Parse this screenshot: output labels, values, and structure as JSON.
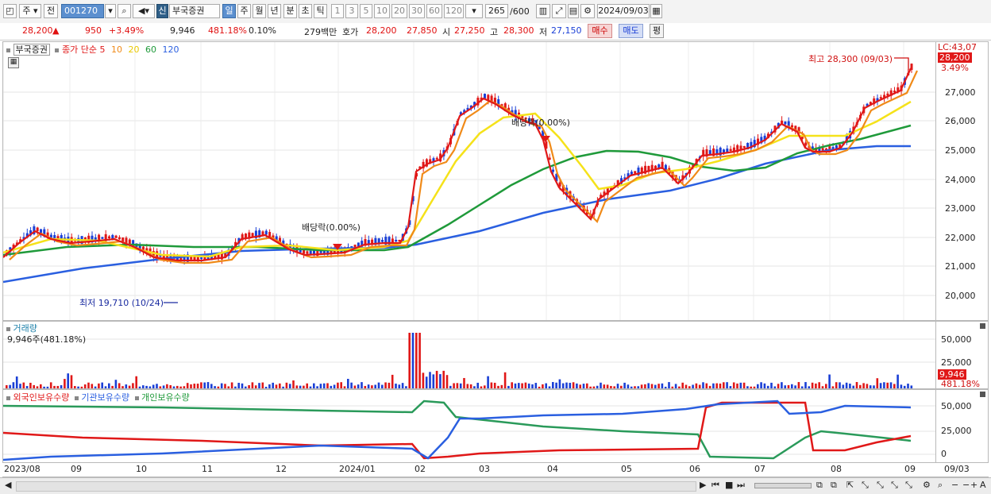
{
  "toolbar": {
    "market": "주",
    "prev": "전",
    "code": "001270",
    "new_badge": "신",
    "stock_name": "부국증권",
    "periods": [
      "일",
      "주",
      "월",
      "년",
      "분",
      "초",
      "틱"
    ],
    "active_period": "일",
    "intervals": [
      "1",
      "3",
      "5",
      "10",
      "20",
      "30",
      "60",
      "120"
    ],
    "count": "265",
    "count_total": "/600",
    "date": "2024/09/03"
  },
  "info": {
    "price": "28,200",
    "up_arrow": "▲",
    "change": "950",
    "change_pct": "+3.49%",
    "volume": "9,946",
    "volume_pct": "481.18%",
    "turnover_pct": "0.10%",
    "amount": "279백만",
    "bid_label": "호가",
    "bid1": "28,200",
    "bid2": "27,850",
    "open_label": "시",
    "open": "27,250",
    "high_label": "고",
    "high": "28,300",
    "low_label": "저",
    "low": "27,150",
    "buy": "매수",
    "sell": "매도",
    "eval": "평"
  },
  "price_panel": {
    "name": "부국증권",
    "legend_label": "종가 단순",
    "ma_periods": [
      "5",
      "10",
      "20",
      "60",
      "120"
    ],
    "ma_colors": [
      "#e01818",
      "#f08a18",
      "#f5e21a",
      "#1f9a3a",
      "#2a5fe0"
    ],
    "high_note": "최고 28,300 (09/03)",
    "low_note": "최저 19,710 (10/24)",
    "dividend1": "배당락(0.00%)",
    "dividend2": "배당락(0.00%)",
    "lc": "LC:43,07",
    "last_price": "28,200",
    "last_pct": "3.49%",
    "y_ticks": [
      "27,000",
      "26,000",
      "25,000",
      "24,000",
      "23,000",
      "22,000",
      "21,000",
      "20,000"
    ]
  },
  "volume_panel": {
    "title": "거래량",
    "value": "9,946주(481.18%)",
    "y_ticks": [
      "50,000",
      "25,000"
    ],
    "last_value": "9,946",
    "last_pct": "481.18%"
  },
  "holding_panel": {
    "series": [
      "외국인보유수량",
      "기관보유수량",
      "개인보유수량"
    ],
    "y_ticks": [
      "50,000",
      "25,000",
      "0"
    ]
  },
  "x_axis": {
    "labels": [
      "2023/08",
      "09",
      "10",
      "11",
      "12",
      "2024/01",
      "02",
      "03",
      "04",
      "05",
      "06",
      "07",
      "08",
      "09"
    ],
    "right_label": "09/03"
  }
}
